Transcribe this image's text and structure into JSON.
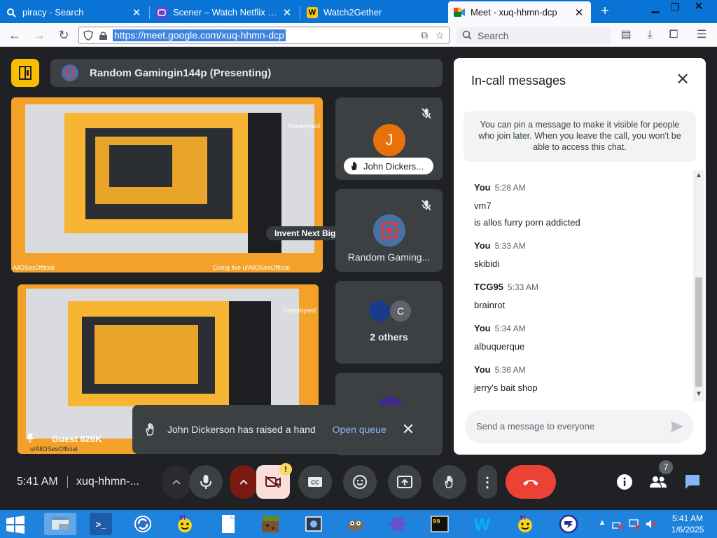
{
  "browser": {
    "tabs": [
      {
        "title": "piracy - Search",
        "favicon": "search-favicon"
      },
      {
        "title": "Scener – Watch Netflix and m",
        "favicon": "scener-favicon"
      },
      {
        "title": "Watch2Gether",
        "favicon": "w2g-favicon"
      },
      {
        "title": "Meet - xuq-hhmn-dcp",
        "favicon": "meet-favicon",
        "active": true
      }
    ],
    "url": "https://meet.google.com/xuq-hhmn-dcp",
    "search_placeholder": "Search"
  },
  "meet": {
    "presenter_title": "Random Gamingin144p (Presenting)",
    "main_screen_overlay": {
      "left": "AllOSesOfficial",
      "right": "Going live u/AllOSesOfficial",
      "corner": "Streamyard"
    },
    "second_screen_overlay": {
      "bottom": "u/AllOSesOfficial",
      "corner": "Streamyard"
    },
    "overlay_label": "Invent Next Big Thing",
    "guest_label": "Guest 826K",
    "participants": [
      {
        "name": "John Dickers...",
        "initial": "J",
        "avatar_color": "#e8710a",
        "hand_raised": true
      },
      {
        "name": "Random Gaming...",
        "initial": "",
        "avatar_color": "#4a6fa5"
      },
      {
        "name": "2 others",
        "initial": "C",
        "avatar_color": "#5f6368"
      }
    ],
    "toast": {
      "text": "John Dickerson has raised a hand",
      "action": "Open queue"
    },
    "clock": "5:41 AM",
    "meeting_code": "xuq-hhmn-...",
    "participant_count": "7",
    "notification_badge": "!"
  },
  "chat": {
    "title": "In-call messages",
    "notice": "You can pin a message to make it visible for people who join later. When you leave the call, you won't be able to access this chat.",
    "messages": [
      {
        "sender": "You",
        "time": "5:28 AM",
        "lines": [
          "vm7",
          "is allos furry porn addicted"
        ]
      },
      {
        "sender": "You",
        "time": "5:33 AM",
        "lines": [
          "skibidi"
        ]
      },
      {
        "sender": "TCG95",
        "time": "5:33 AM",
        "lines": [
          "brainrot"
        ]
      },
      {
        "sender": "You",
        "time": "5:34 AM",
        "lines": [
          "albuquerque"
        ]
      },
      {
        "sender": "You",
        "time": "5:36 AM",
        "lines": [
          "jerry's bait shop"
        ]
      }
    ],
    "input_placeholder": "Send a message to everyone"
  },
  "taskbar": {
    "time": "5:41 AM",
    "date": "1/6/2025",
    "apps": [
      "file-manager",
      "powershell",
      "sync-app",
      "yahoo-messenger",
      "notepad",
      "minecraft",
      "screenshot-tool",
      "gimp",
      "bug-app",
      "terminal-99",
      "word",
      "yahoo-messenger-2",
      "browser-app"
    ]
  },
  "colors": {
    "accent": "#1a73e8",
    "meet_bg": "#202124",
    "tile_bg": "#3c4043",
    "hangup": "#ea4335",
    "present": "#fbbc04",
    "taskbar": "#1f83de"
  }
}
